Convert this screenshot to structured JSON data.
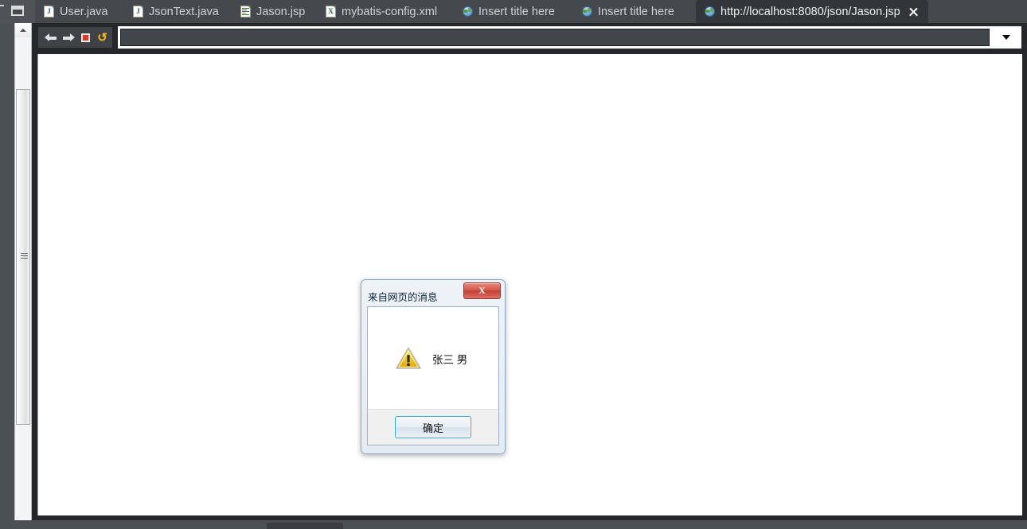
{
  "window": {
    "restore_icon": "window-restore-icon",
    "background_color": "#4b5055"
  },
  "tabstrip": {
    "tabs": [
      {
        "label": "User.java",
        "icon": "java-file-icon",
        "icon_letter": "J",
        "active": false
      },
      {
        "label": "JsonText.java",
        "icon": "java-file-icon",
        "icon_letter": "J",
        "active": false
      },
      {
        "label": "Jason.jsp",
        "icon": "jsp-file-icon",
        "icon_letter": "",
        "active": false
      },
      {
        "label": "mybatis-config.xml",
        "icon": "xml-file-icon",
        "icon_letter": "X",
        "active": false
      },
      {
        "label": "Insert title here",
        "icon": "globe-icon",
        "icon_letter": "",
        "active": false
      },
      {
        "label": "Insert title here",
        "icon": "globe-icon",
        "icon_letter": "",
        "active": false
      },
      {
        "label": "http://localhost:8080/json/Jason.jsp",
        "icon": "globe-icon",
        "icon_letter": "",
        "active": true,
        "closable": true
      }
    ],
    "active_tab_bg": "#32363a"
  },
  "toolbar": {
    "back_icon": "back-arrow-icon",
    "forward_icon": "forward-arrow-icon",
    "stop_icon": "stop-icon",
    "refresh_icon": "refresh-icon",
    "address_value": "",
    "address_placeholder": "",
    "dropdown_icon": "chevron-down-icon"
  },
  "scrollbar": {
    "up_arrow_icon": "scroll-up-arrow-icon",
    "grip_icon": "scrollbar-grip-icon"
  },
  "dialog": {
    "title": "来自网页的消息",
    "close_label": "X",
    "warning_icon": "warning-triangle-icon",
    "message": "张三 男",
    "ok_label": "确定",
    "accent_color": "#2aa8e8",
    "close_color": "#c23f33",
    "warning_color": "#f2c118"
  }
}
